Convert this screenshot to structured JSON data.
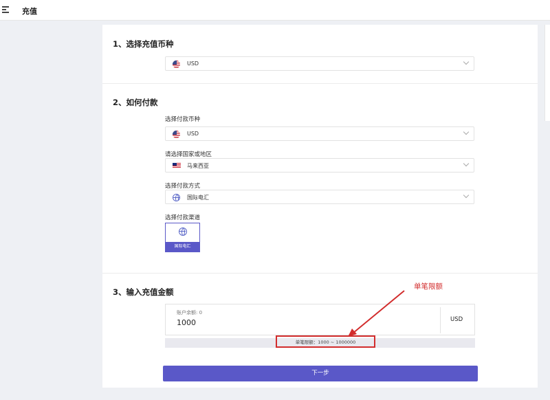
{
  "header": {
    "title": "充值",
    "menu_icon": "menu-fold-icon"
  },
  "section1": {
    "title": "1、选择充值币种",
    "currency": {
      "value": "USD",
      "icon": "us-flag-icon"
    }
  },
  "section2": {
    "title": "2、如何付款",
    "pay_currency": {
      "label": "选择付款币种",
      "value": "USD",
      "icon": "us-flag-icon"
    },
    "country": {
      "label": "请选择国家或地区",
      "value": "马来西亚",
      "icon": "my-flag-icon"
    },
    "method": {
      "label": "选择付款方式",
      "value": "国际电汇",
      "icon": "globe-icon"
    },
    "channel": {
      "label": "选择付款渠道",
      "value": "国际电汇",
      "icon": "globe-icon"
    }
  },
  "section3": {
    "title": "3、输入充值金额",
    "balance_label": "账户余额: 0",
    "amount_value": "1000",
    "currency": "USD",
    "limit_text": "单笔限额：1000 ~ 1000000"
  },
  "annotation": {
    "text": "单笔限额",
    "color": "#d22c2c"
  },
  "actions": {
    "next_label": "下一步"
  },
  "colors": {
    "accent": "#5a58c8",
    "annotation": "#d22c2c"
  }
}
